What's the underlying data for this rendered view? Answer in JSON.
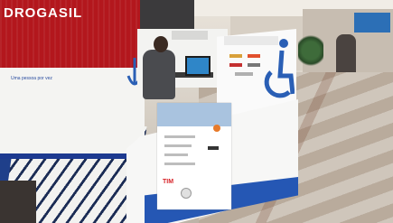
{
  "store_sign": "DROGASIL",
  "left_wall_text": "Uma pessoa por vez",
  "back_panel_text": "",
  "front_logo": "TIM",
  "colors": {
    "store_red": "#b3171d",
    "kiosk_blue": "#2557b4",
    "accent_blue": "#2c6fb6"
  }
}
